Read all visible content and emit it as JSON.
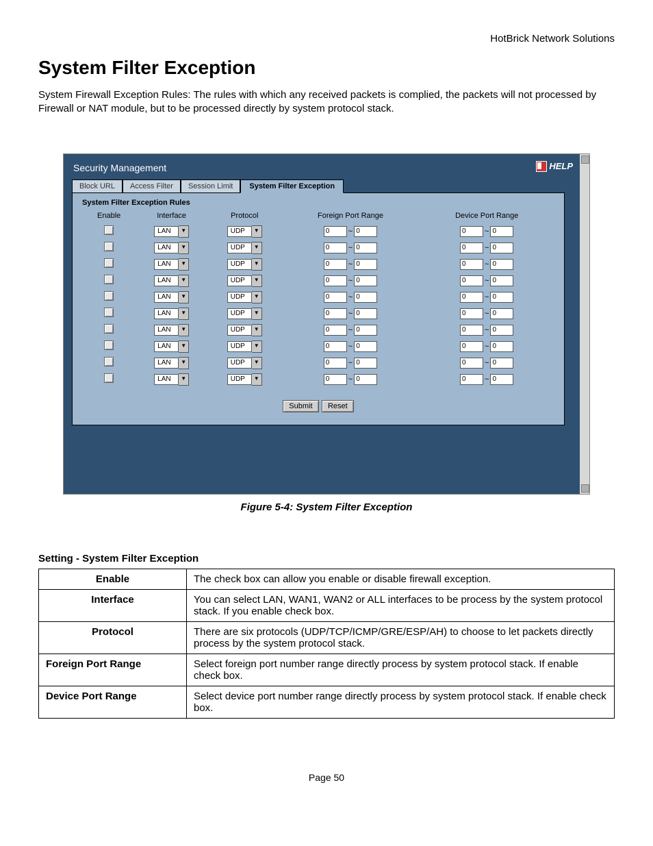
{
  "header_company": "HotBrick Network Solutions",
  "page_title": "System Filter Exception",
  "intro": "System Firewall Exception Rules: The rules with which any received packets is complied, the packets will not processed by Firewall or NAT module, but to be processed directly by system protocol stack.",
  "screenshot": {
    "section_title": "Security Management",
    "help_label": "HELP",
    "tabs": [
      "Block URL",
      "Access Filter",
      "Session Limit",
      "System Filter Exception"
    ],
    "active_tab": "System Filter Exception",
    "panel_title": "System Filter Exception Rules",
    "columns": [
      "Enable",
      "Interface",
      "Protocol",
      "Foreign Port Range",
      "Device Port Range"
    ],
    "interface_value": "LAN",
    "protocol_value": "UDP",
    "port_value": "0",
    "row_count": 10,
    "submit_label": "Submit",
    "reset_label": "Reset"
  },
  "figure_caption": "Figure 5-4: System Filter Exception",
  "settings_title": "Setting - System Filter Exception",
  "settings_rows": [
    {
      "label": "Enable",
      "desc": "The check box can allow you enable or disable firewall exception.",
      "align": "center"
    },
    {
      "label": "Interface",
      "desc": "You can select LAN, WAN1, WAN2 or ALL interfaces to be process by the system protocol stack. If you enable check box.",
      "align": "center"
    },
    {
      "label": "Protocol",
      "desc": "There are six protocols (UDP/TCP/ICMP/GRE/ESP/AH) to choose to let packets directly process by the system protocol stack.",
      "align": "center"
    },
    {
      "label": "Foreign Port Range",
      "desc": "Select foreign port number range directly process by system protocol stack. If enable check box.",
      "align": "left"
    },
    {
      "label": "Device Port Range",
      "desc": "Select device port number range directly process by system protocol stack. If enable check box.",
      "align": "left"
    }
  ],
  "page_number": "Page 50"
}
